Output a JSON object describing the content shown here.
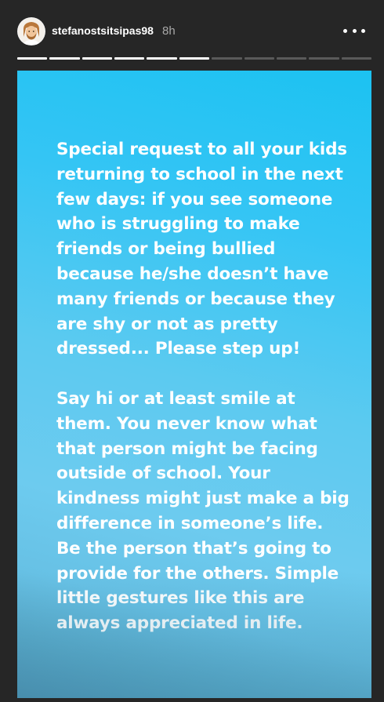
{
  "header": {
    "username": "stefanostsitsipas98",
    "time_ago": "8h",
    "avatar_icon": "memoji-avatar-icon",
    "more_icon": "more-options-icon"
  },
  "progress": {
    "total_segments": 11,
    "completed_segments": 6
  },
  "story": {
    "paragraphs": [
      "Special request to all your kids\nreturning to school in the next\nfew days: if you see someone\nwho is struggling to make\nfriends or being bullied\nbecause he/she doesn’t have\nmany friends or because they\nare shy or not as pretty\ndressed... Please step up!",
      "Say hi or at least smile at\nthem. You never know what\nthat person might be facing\noutside of school. Your\nkindness might just make a big\ndifference in someone’s life.\nBe the person that’s going to\nprovide for the others. Simple\nlittle gestures like this are\nalways appreciated in life."
    ],
    "background_colors": [
      "#1cc2f2",
      "#6dcbef",
      "#4e94b4"
    ]
  }
}
